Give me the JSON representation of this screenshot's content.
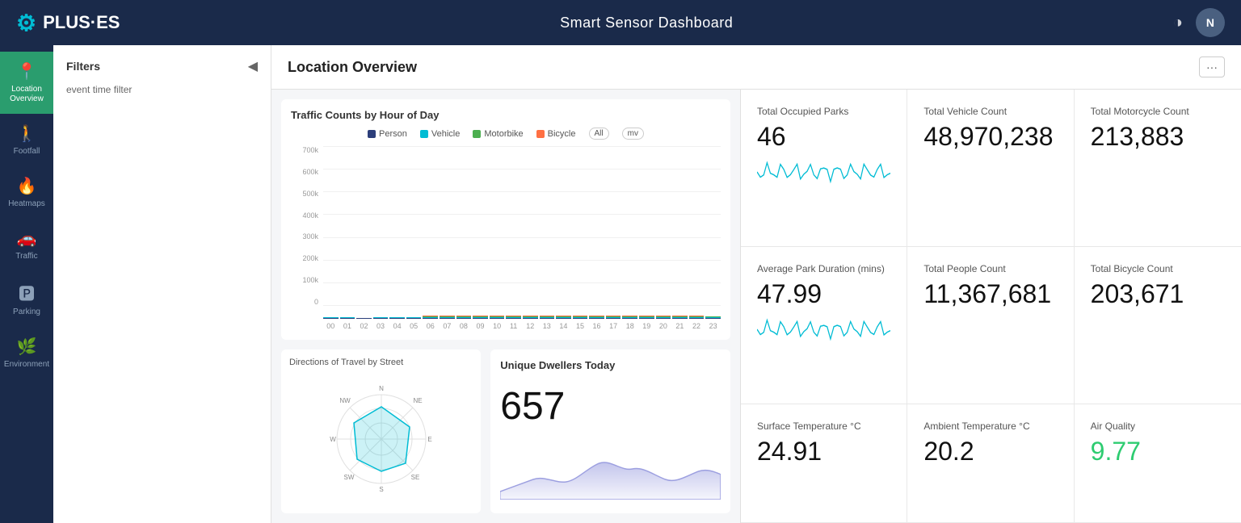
{
  "header": {
    "title": "Smart Sensor Dashboard",
    "logo_text": "PLUS·ES",
    "avatar_label": "N"
  },
  "sidebar": {
    "items": [
      {
        "id": "location",
        "label": "Location Overview",
        "icon": "📍",
        "active": true
      },
      {
        "id": "footfall",
        "label": "Footfall",
        "icon": "🚶"
      },
      {
        "id": "heatmaps",
        "label": "Heatmaps",
        "icon": "🔥"
      },
      {
        "id": "traffic",
        "label": "Traffic",
        "icon": "🚗"
      },
      {
        "id": "parking",
        "label": "Parking",
        "icon": "🅿"
      },
      {
        "id": "environment",
        "label": "Environment",
        "icon": "🌿"
      }
    ]
  },
  "filters": {
    "title": "Filters",
    "event_time_label": "event time filter"
  },
  "dashboard": {
    "title": "Location Overview",
    "options_btn": "···"
  },
  "chart": {
    "title": "Traffic Counts by Hour of Day",
    "y_labels": [
      "700k",
      "600k",
      "500k",
      "400k",
      "300k",
      "200k",
      "100k",
      "0"
    ],
    "x_labels": [
      "00",
      "01",
      "02",
      "03",
      "04",
      "05",
      "06",
      "07",
      "08",
      "09",
      "10",
      "11",
      "12",
      "13",
      "14",
      "15",
      "16",
      "17",
      "18",
      "19",
      "20",
      "21",
      "22",
      "23"
    ],
    "legend": [
      {
        "label": "Person",
        "color": "#2c3e7a"
      },
      {
        "label": "Vehicle",
        "color": "#00bcd4"
      },
      {
        "label": "Motorbike",
        "color": "#4caf50"
      },
      {
        "label": "Bicycle",
        "color": "#ff7043"
      }
    ],
    "bars": [
      {
        "person": 2,
        "vehicle": 1,
        "motorbike": 0,
        "bicycle": 0
      },
      {
        "person": 1,
        "vehicle": 1,
        "motorbike": 0,
        "bicycle": 0
      },
      {
        "person": 1,
        "vehicle": 0,
        "motorbike": 0,
        "bicycle": 0
      },
      {
        "person": 2,
        "vehicle": 1,
        "motorbike": 0,
        "bicycle": 0
      },
      {
        "person": 2,
        "vehicle": 1,
        "motorbike": 0,
        "bicycle": 0
      },
      {
        "person": 5,
        "vehicle": 2,
        "motorbike": 0,
        "bicycle": 0
      },
      {
        "person": 25,
        "vehicle": 10,
        "motorbike": 1,
        "bicycle": 1
      },
      {
        "person": 180,
        "vehicle": 280,
        "motorbike": 10,
        "bicycle": 5
      },
      {
        "person": 200,
        "vehicle": 280,
        "motorbike": 12,
        "bicycle": 5
      },
      {
        "person": 180,
        "vehicle": 270,
        "motorbike": 12,
        "bicycle": 5
      },
      {
        "person": 190,
        "vehicle": 280,
        "motorbike": 10,
        "bicycle": 5
      },
      {
        "person": 185,
        "vehicle": 270,
        "motorbike": 10,
        "bicycle": 4
      },
      {
        "person": 190,
        "vehicle": 275,
        "motorbike": 11,
        "bicycle": 5
      },
      {
        "person": 195,
        "vehicle": 380,
        "motorbike": 12,
        "bicycle": 5
      },
      {
        "person": 180,
        "vehicle": 380,
        "motorbike": 12,
        "bicycle": 5
      },
      {
        "person": 200,
        "vehicle": 590,
        "motorbike": 12,
        "bicycle": 5
      },
      {
        "person": 160,
        "vehicle": 320,
        "motorbike": 10,
        "bicycle": 4
      },
      {
        "person": 140,
        "vehicle": 260,
        "motorbike": 8,
        "bicycle": 3
      },
      {
        "person": 100,
        "vehicle": 195,
        "motorbike": 7,
        "bicycle": 3
      },
      {
        "person": 80,
        "vehicle": 120,
        "motorbike": 5,
        "bicycle": 2
      },
      {
        "person": 60,
        "vehicle": 75,
        "motorbike": 4,
        "bicycle": 2
      },
      {
        "person": 35,
        "vehicle": 35,
        "motorbike": 2,
        "bicycle": 1
      },
      {
        "person": 20,
        "vehicle": 20,
        "motorbike": 1,
        "bicycle": 1
      },
      {
        "person": 8,
        "vehicle": 8,
        "motorbike": 1,
        "bicycle": 0
      }
    ]
  },
  "metrics": [
    {
      "id": "occupied_parks",
      "label": "Total Occupied Parks",
      "value": "46",
      "has_sparkline": true,
      "sparkline_color": "#00bcd4"
    },
    {
      "id": "vehicle_count",
      "label": "Total Vehicle Count",
      "value": "48,970,238",
      "has_sparkline": false
    },
    {
      "id": "motorcycle_count",
      "label": "Total Motorcycle Count",
      "value": "213,883",
      "has_sparkline": false
    },
    {
      "id": "park_duration",
      "label": "Average Park Duration (mins)",
      "value": "47.99",
      "has_sparkline": true,
      "sparkline_color": "#00bcd4"
    },
    {
      "id": "people_count",
      "label": "Total People Count",
      "value": "11,367,681",
      "has_sparkline": false
    },
    {
      "id": "bicycle_count",
      "label": "Total Bicycle Count",
      "value": "203,671",
      "has_sparkline": false
    },
    {
      "id": "surface_temp",
      "label": "Surface Temperature °C",
      "value": "24.91",
      "has_sparkline": false
    },
    {
      "id": "ambient_temp",
      "label": "Ambient Temperature °C",
      "value": "20.2",
      "has_sparkline": false
    },
    {
      "id": "air_quality",
      "label": "Air Quality",
      "value": "9.77",
      "has_sparkline": false,
      "value_class": "green"
    }
  ],
  "bottom": {
    "directions_title": "Directions of Travel by Street",
    "dwellers_title": "Unique Dwellers Today",
    "dwellers_value": "657"
  }
}
